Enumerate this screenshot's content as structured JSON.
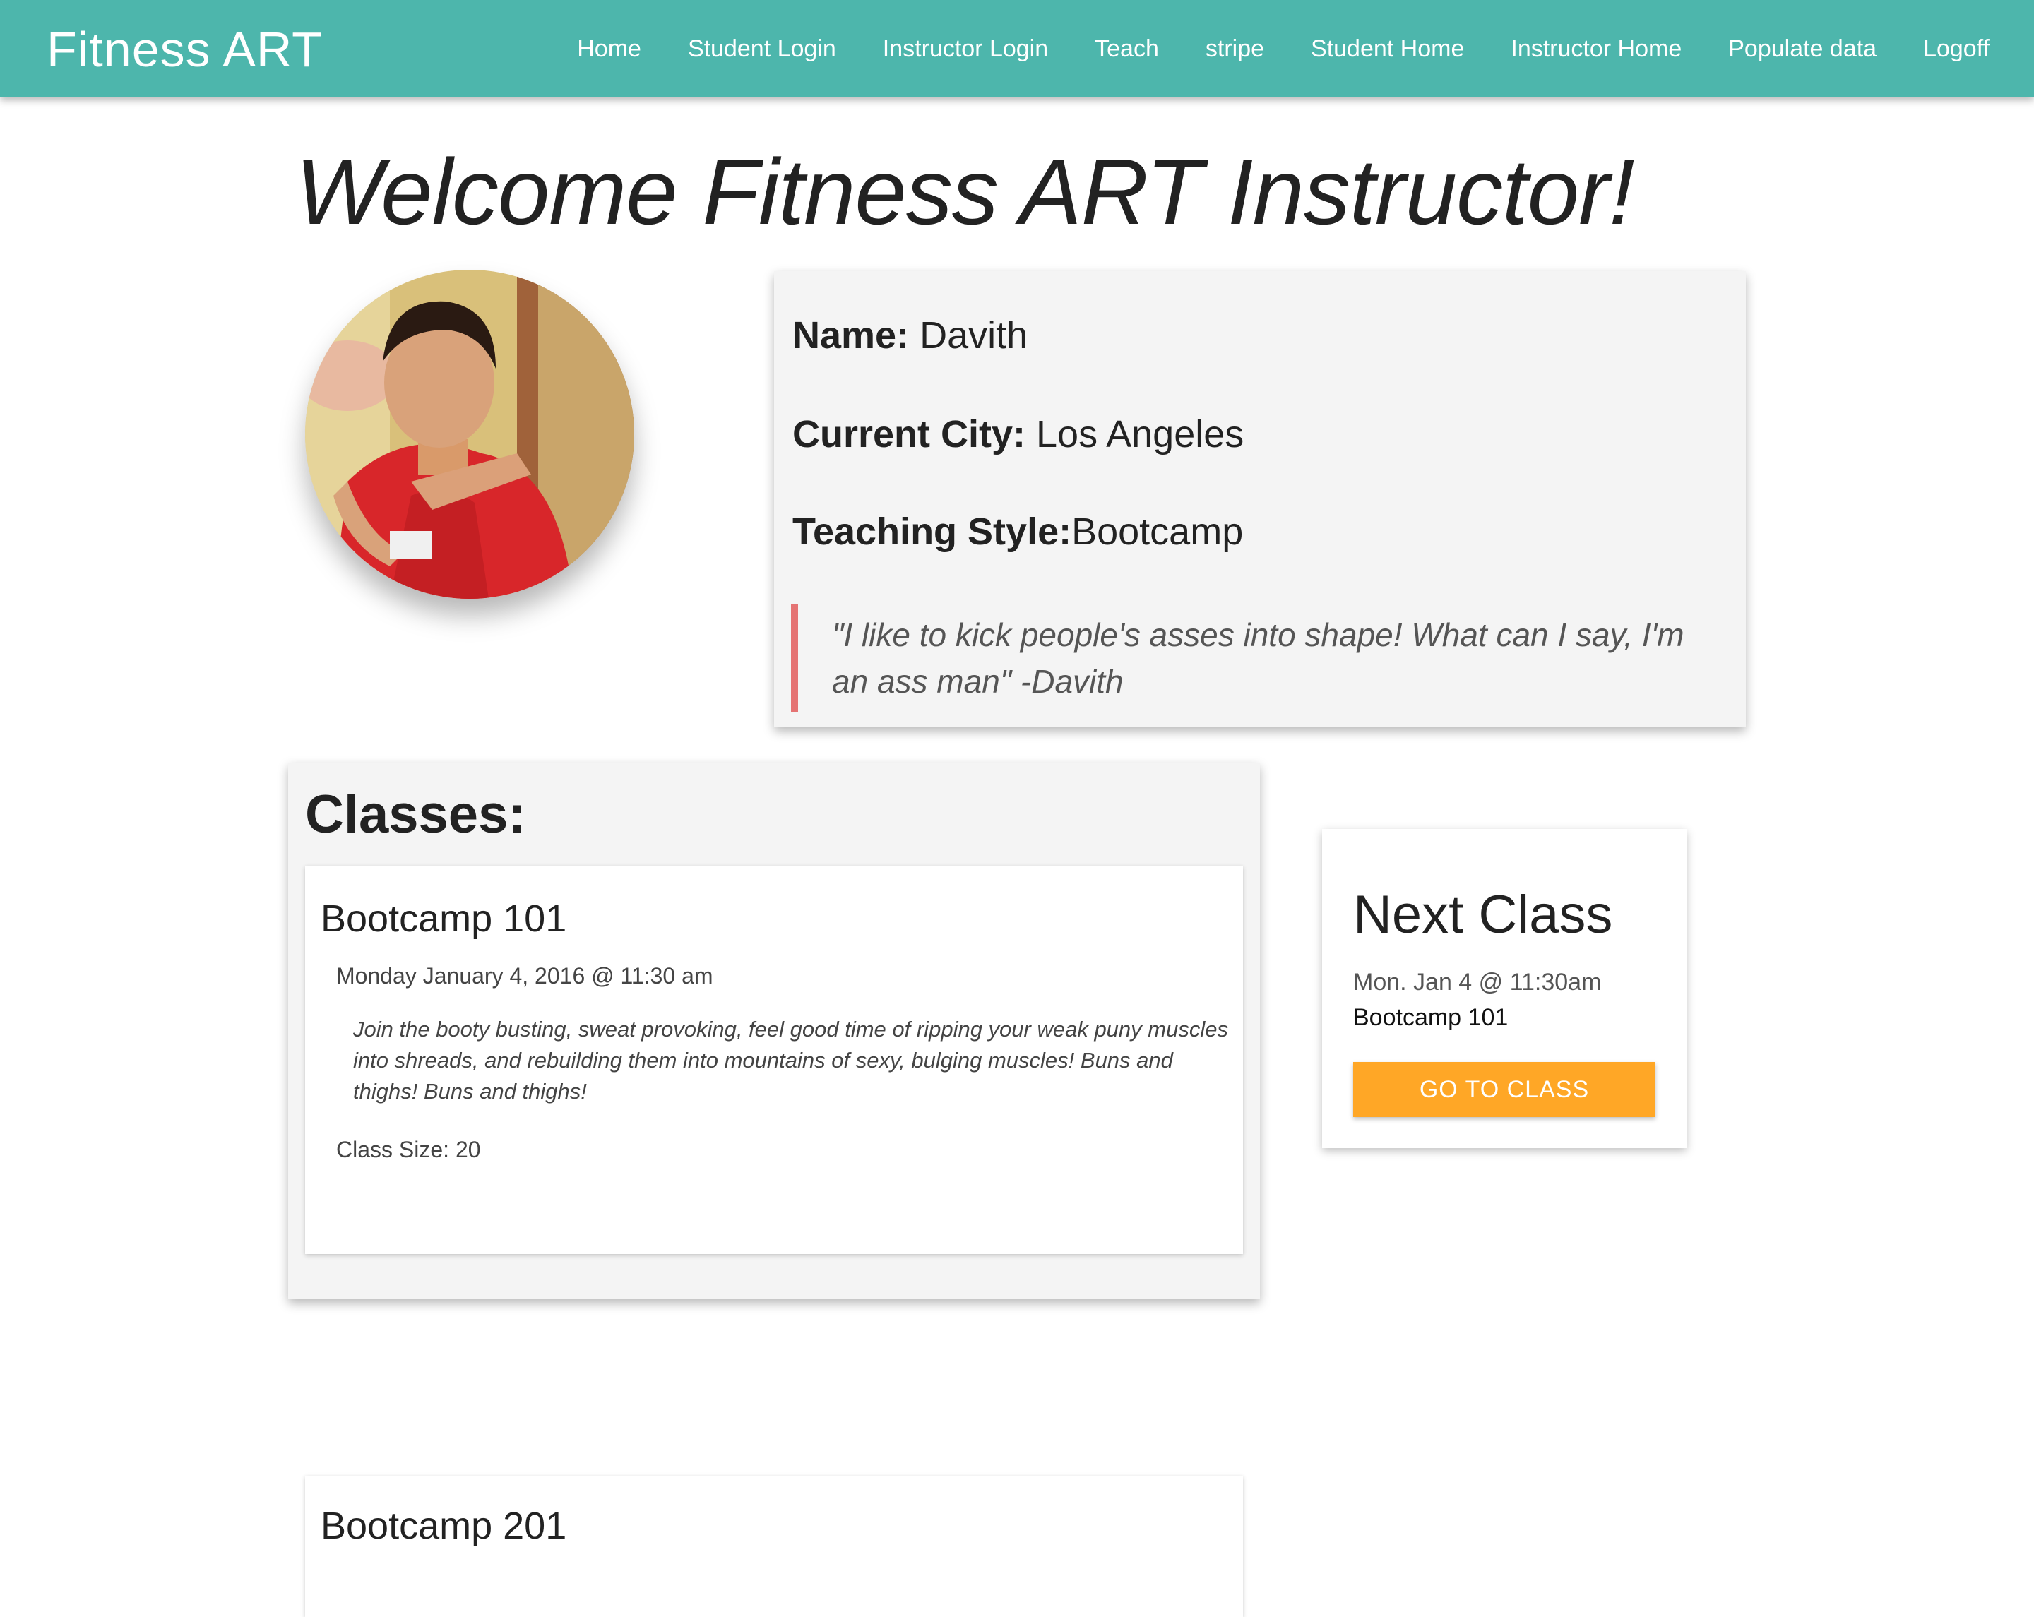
{
  "navbar": {
    "brand": "Fitness ART",
    "links": [
      "Home",
      "Student Login",
      "Instructor Login",
      "Teach",
      "stripe",
      "Student Home",
      "Instructor Home",
      "Populate data",
      "Logoff"
    ]
  },
  "welcome": "Welcome Fitness ART Instructor!",
  "profile": {
    "name_label": "Name:",
    "name": " Davith",
    "city_label": "Current City:",
    "city": " Los Angeles",
    "style_label": "Teaching Style:",
    "style": "Bootcamp",
    "quote": "\"I like to kick people's asses into shape! What can I say, I'm an ass man\" -Davith"
  },
  "classes": {
    "title": "Classes:",
    "items": [
      {
        "name": "Bootcamp 101",
        "date": "Monday January 4, 2016 @ 11:30 am",
        "description": "Join the booty busting, sweat provoking, feel good time of ripping your weak puny muscles into shreads, and rebuilding them into mountains of sexy, bulging muscles! Buns and thighs! Buns and thighs!",
        "size": "Class Size: 20"
      },
      {
        "name": "Bootcamp 201"
      }
    ]
  },
  "next_class": {
    "title": "Next Class",
    "date": "Mon. Jan 4 @ 11:30am",
    "name": "Bootcamp 101",
    "button": "GO TO CLASS"
  },
  "colors": {
    "navbar": "#4db6ac",
    "button": "#ffa726",
    "quote_border": "#e57373",
    "card_bg": "#f4f4f4"
  }
}
